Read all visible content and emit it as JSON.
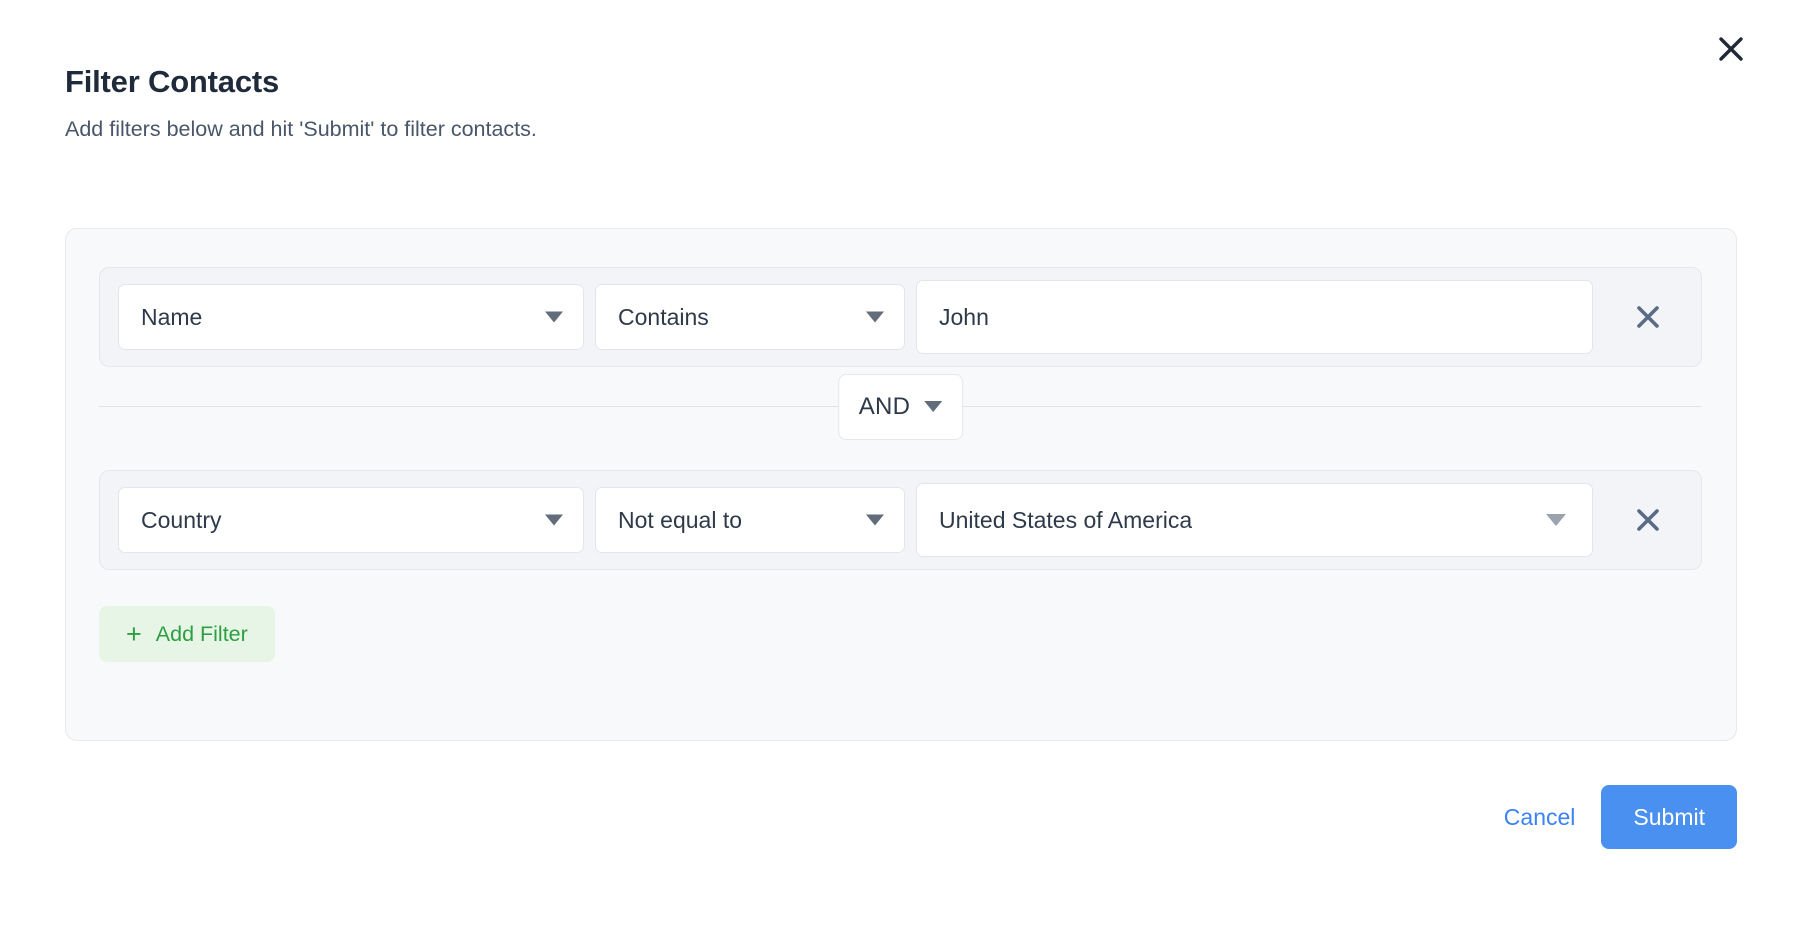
{
  "dialog": {
    "title": "Filter Contacts",
    "subtitle": "Add filters below and hit 'Submit' to filter contacts.",
    "close_icon": "close-icon"
  },
  "filters": [
    {
      "attribute": "Name",
      "operator": "Contains",
      "value": "John",
      "value_type": "text",
      "remove_icon": "close-icon"
    },
    {
      "attribute": "Country",
      "operator": "Not equal to",
      "value": "United States of America",
      "value_type": "select",
      "remove_icon": "close-icon"
    }
  ],
  "connector": {
    "label": "AND",
    "caret_icon": "chevron-down-icon"
  },
  "add_filter": {
    "plus_icon": "+",
    "label": "Add Filter"
  },
  "footer": {
    "cancel_label": "Cancel",
    "submit_label": "Submit"
  },
  "colors": {
    "accent_blue": "#4a90f0",
    "link_blue": "#3b82f6",
    "add_filter_green": "#2f9e41",
    "add_filter_bg": "#e6f5e6",
    "panel_bg": "#f8f9fb",
    "row_bg": "#f2f4f7",
    "text_dark": "#2e3a4a",
    "remove_icon": "#5a6b85"
  }
}
